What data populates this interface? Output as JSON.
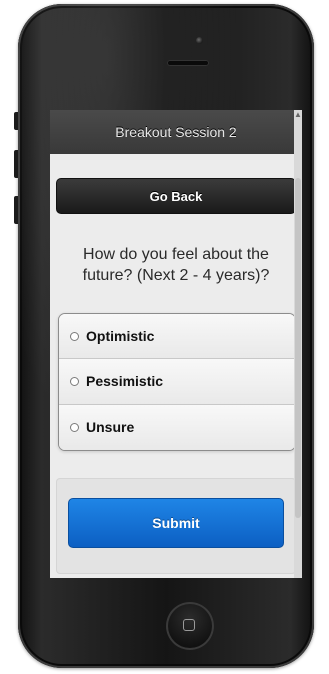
{
  "header": {
    "title": "Breakout Session 2"
  },
  "actions": {
    "go_back_label": "Go Back",
    "submit_label": "Submit"
  },
  "poll": {
    "question": "How do you feel about the future? (Next 2 - 4 years)?",
    "options": [
      {
        "label": "Optimistic",
        "selected": false
      },
      {
        "label": "Pessimistic",
        "selected": false
      },
      {
        "label": "Unsure",
        "selected": false
      }
    ]
  },
  "colors": {
    "header_bg": "#3f3f3f",
    "go_back_bg": "#262626",
    "submit_bg": "#1473d6",
    "screen_bg": "#ececec",
    "phone_body": "#161616"
  },
  "icons": {
    "scroll_up": "▲",
    "home_button": "square"
  }
}
